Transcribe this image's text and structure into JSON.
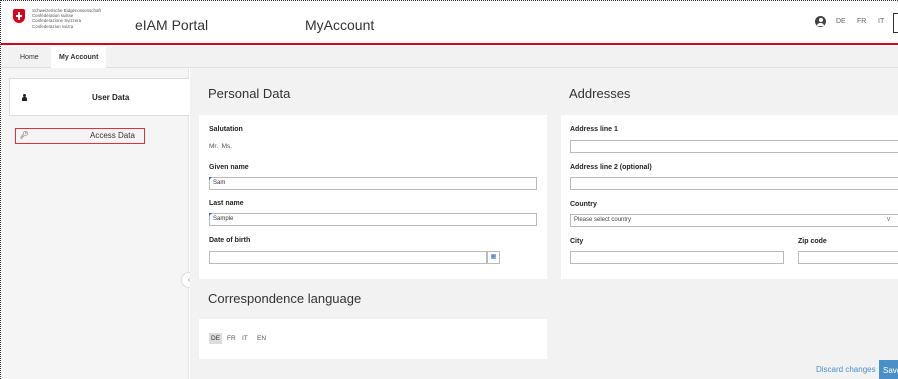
{
  "header": {
    "confederation": [
      "Schweizerische Eidgenossenschaft",
      "Confédération suisse",
      "Confederazione Svizzera",
      "Confederaziun svizra"
    ],
    "portal_title": "eIAM Portal",
    "app_title": "MyAccount",
    "languages": [
      "DE",
      "FR",
      "IT"
    ],
    "accent_color": "#dc0018"
  },
  "tabs": [
    {
      "label": "Home"
    },
    {
      "label": "My Account"
    }
  ],
  "sidebar": {
    "items": [
      {
        "label": "User Data",
        "icon": "user-icon"
      },
      {
        "label": "Access Data",
        "icon": "key-icon"
      }
    ]
  },
  "personal": {
    "title": "Personal Data",
    "salutation_label": "Salutation",
    "salutation_options": "Mr.  Ms.",
    "given_name_label": "Given name",
    "given_name_value": "Sam",
    "last_name_label": "Last name",
    "last_name_value": "Sample",
    "dob_label": "Date of birth",
    "dob_value": ""
  },
  "addresses": {
    "title": "Addresses",
    "line1_label": "Address line 1",
    "line2_label": "Address line 2 (optional)",
    "country_label": "Country",
    "country_placeholder": "Please select country",
    "city_label": "City",
    "zip_label": "Zip code"
  },
  "correspondence": {
    "title": "Correspondence language",
    "options": [
      "DE",
      "FR",
      "IT",
      "EN"
    ],
    "selected": "DE"
  },
  "actions": {
    "discard": "Discard changes",
    "save": "Save"
  }
}
